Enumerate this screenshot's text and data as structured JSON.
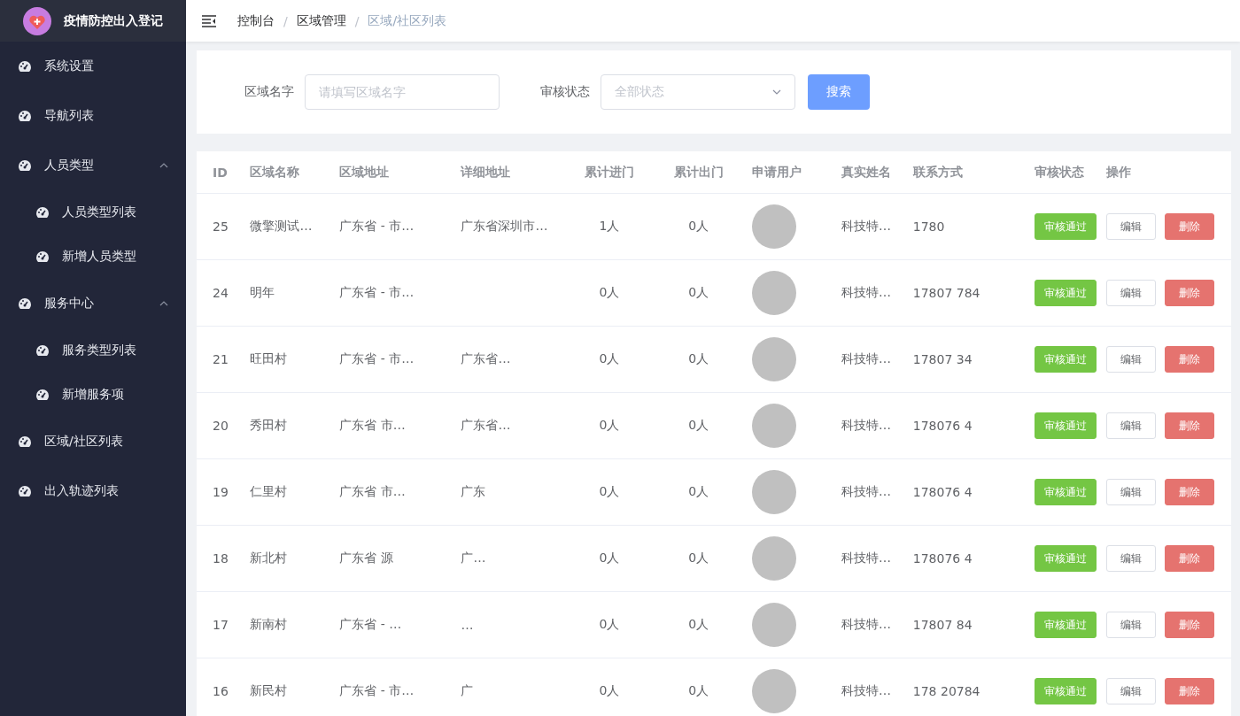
{
  "app": {
    "title": "疫情防控出入登记"
  },
  "sidebar": {
    "items": [
      {
        "label": "系统设置"
      },
      {
        "label": "导航列表"
      },
      {
        "label": "人员类型",
        "expanded": true,
        "children": [
          {
            "label": "人员类型列表"
          },
          {
            "label": "新增人员类型"
          }
        ]
      },
      {
        "label": "服务中心",
        "expanded": true,
        "children": [
          {
            "label": "服务类型列表"
          },
          {
            "label": "新增服务项"
          }
        ]
      },
      {
        "label": "区域/社区列表"
      },
      {
        "label": "出入轨迹列表"
      }
    ]
  },
  "breadcrumb": [
    {
      "label": "控制台",
      "current": false
    },
    {
      "label": "区域管理",
      "current": false
    },
    {
      "label": "区域/社区列表",
      "current": true
    }
  ],
  "breadcrumb_separator": "/",
  "filters": {
    "name_label": "区域名字",
    "name_placeholder": "请填写区域名字",
    "status_label": "审核状态",
    "status_placeholder": "全部状态",
    "search_button": "搜索"
  },
  "table": {
    "columns": [
      "ID",
      "区域名称",
      "区域地址",
      "详细地址",
      "累计进门",
      "累计出门",
      "申请用户",
      "真实姓名",
      "联系方式",
      "审核状态",
      "操作"
    ],
    "rows": [
      {
        "id": "25",
        "name": "微擎测试…",
        "address": "广东省 - 市…",
        "detail": "广东省深圳市…",
        "in": "1人",
        "out": "0人",
        "real_name": "科技特…",
        "phone": "1780",
        "status": "审核通过",
        "edit": "编辑",
        "delete": "删除"
      },
      {
        "id": "24",
        "name": "明年",
        "address": "广东省 - 市…",
        "detail": "",
        "in": "0人",
        "out": "0人",
        "real_name": "科技特…",
        "phone": "17807 784",
        "status": "审核通过",
        "edit": "编辑",
        "delete": "删除"
      },
      {
        "id": "21",
        "name": "旺田村",
        "address": "广东省 - 市…",
        "detail": "广东省…",
        "in": "0人",
        "out": "0人",
        "real_name": "科技特…",
        "phone": "17807 34",
        "status": "审核通过",
        "edit": "编辑",
        "delete": "删除"
      },
      {
        "id": "20",
        "name": "秀田村",
        "address": "广东省 市…",
        "detail": "广东省…",
        "in": "0人",
        "out": "0人",
        "real_name": "科技特…",
        "phone": "178076 4",
        "status": "审核通过",
        "edit": "编辑",
        "delete": "删除"
      },
      {
        "id": "19",
        "name": "仁里村",
        "address": "广东省 市…",
        "detail": "广东",
        "in": "0人",
        "out": "0人",
        "real_name": "科技特…",
        "phone": "178076 4",
        "status": "审核通过",
        "edit": "编辑",
        "delete": "删除"
      },
      {
        "id": "18",
        "name": "新北村",
        "address": "广东省 源",
        "detail": "广…",
        "in": "0人",
        "out": "0人",
        "real_name": "科技特…",
        "phone": "178076 4",
        "status": "审核通过",
        "edit": "编辑",
        "delete": "删除"
      },
      {
        "id": "17",
        "name": "新南村",
        "address": "广东省 - …",
        "detail": "…",
        "in": "0人",
        "out": "0人",
        "real_name": "科技特…",
        "phone": "17807 84",
        "status": "审核通过",
        "edit": "编辑",
        "delete": "删除"
      },
      {
        "id": "16",
        "name": "新民村",
        "address": "广东省 - 市…",
        "detail": "广",
        "in": "0人",
        "out": "0人",
        "real_name": "科技特…",
        "phone": "178 20784",
        "status": "审核通过",
        "edit": "编辑",
        "delete": "删除"
      }
    ]
  }
}
